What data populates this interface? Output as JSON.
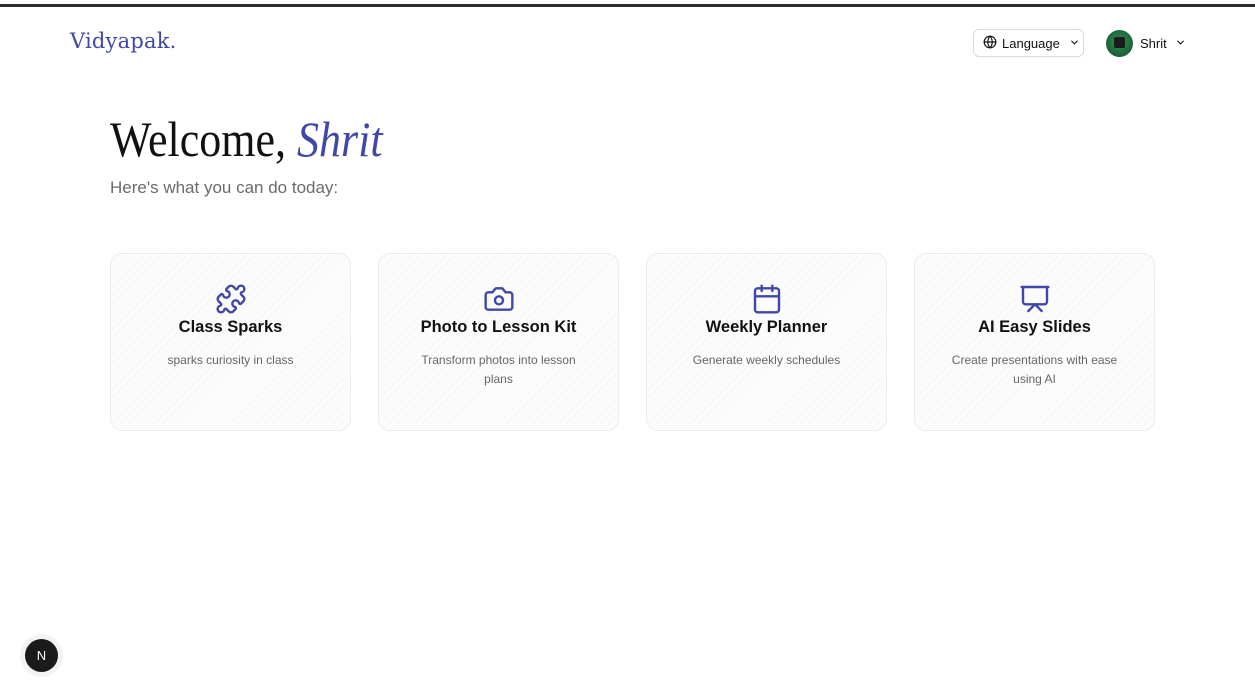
{
  "header": {
    "brand": "Vidyapak.",
    "language_label": "Language",
    "user_name": "Shrit"
  },
  "hero": {
    "greeting": "Welcome,",
    "name": "Shrit",
    "subtitle": "Here's what you can do today:"
  },
  "cards": [
    {
      "icon": "puzzle-icon",
      "title": "Class Sparks",
      "description": "sparks curiosity in class"
    },
    {
      "icon": "camera-icon",
      "title": "Photo to Lesson Kit",
      "description": "Transform photos into lesson plans"
    },
    {
      "icon": "calendar-icon",
      "title": "Weekly Planner",
      "description": "Generate weekly schedules"
    },
    {
      "icon": "presentation-icon",
      "title": "AI Easy Slides",
      "description": "Create presentations with ease using AI"
    }
  ],
  "dev_badge": {
    "label": "N"
  },
  "colors": {
    "accent": "#3f48a6",
    "text": "#111111",
    "muted": "#6b6b6b",
    "card_border": "#ececf0"
  }
}
